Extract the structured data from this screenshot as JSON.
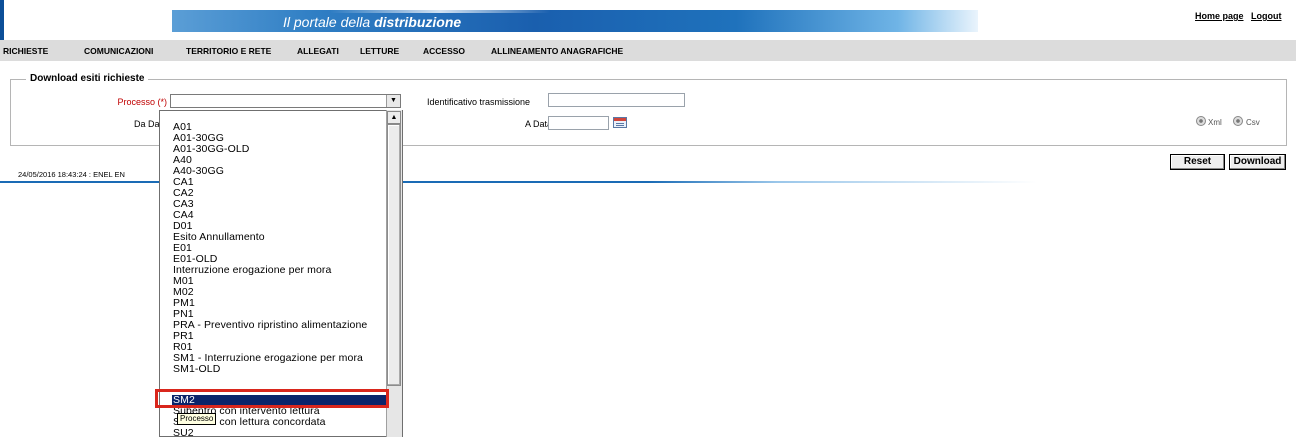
{
  "header": {
    "title_prefix": "Il portale della ",
    "title_bold": "distribuzione",
    "links": [
      "Home page",
      "Logout"
    ]
  },
  "menu": [
    "RICHIESTE",
    "COMUNICAZIONI",
    "TERRITORIO E RETE",
    "ALLEGATI",
    "LETTURE",
    "ACCESSO",
    "ALLINEAMENTO ANAGRAFICHE"
  ],
  "form": {
    "legend": "Download esiti richieste",
    "processo_label": "Processo (*)",
    "da_data_label": "Da Data",
    "identificativo_label": "Identificativo trasmissione",
    "a_data_label": "A Data",
    "format_options": [
      "Xml",
      "Csv"
    ]
  },
  "buttons": {
    "reset": "Reset",
    "download": "Download"
  },
  "status": {
    "text": "24/05/2016 18:43:24  :  ENEL EN"
  },
  "dropdown": {
    "items": [
      "A01",
      "A01-30GG",
      "A01-30GG-OLD",
      "A40",
      "A40-30GG",
      "CA1",
      "CA2",
      "CA3",
      "CA4",
      "D01",
      "Esito Annullamento",
      "E01",
      "E01-OLD",
      "Interruzione erogazione per mora",
      "M01",
      "M02",
      "PM1",
      "PN1",
      "PRA - Preventivo ripristino alimentazione",
      "PR1",
      "R01",
      "SM1 - Interruzione erogazione per mora",
      "SM1-OLD",
      "SM2",
      "Subentro con intervento lettura",
      "Subentro con lettura concordata",
      "SU2"
    ],
    "selected": "SM2"
  },
  "tooltip": "Processo",
  "colors": {
    "banner": "#1a5fae",
    "menubar": "#dcdcdc",
    "selection": "#0a246a",
    "highlight": "#d9261c",
    "required": "#c00000"
  }
}
